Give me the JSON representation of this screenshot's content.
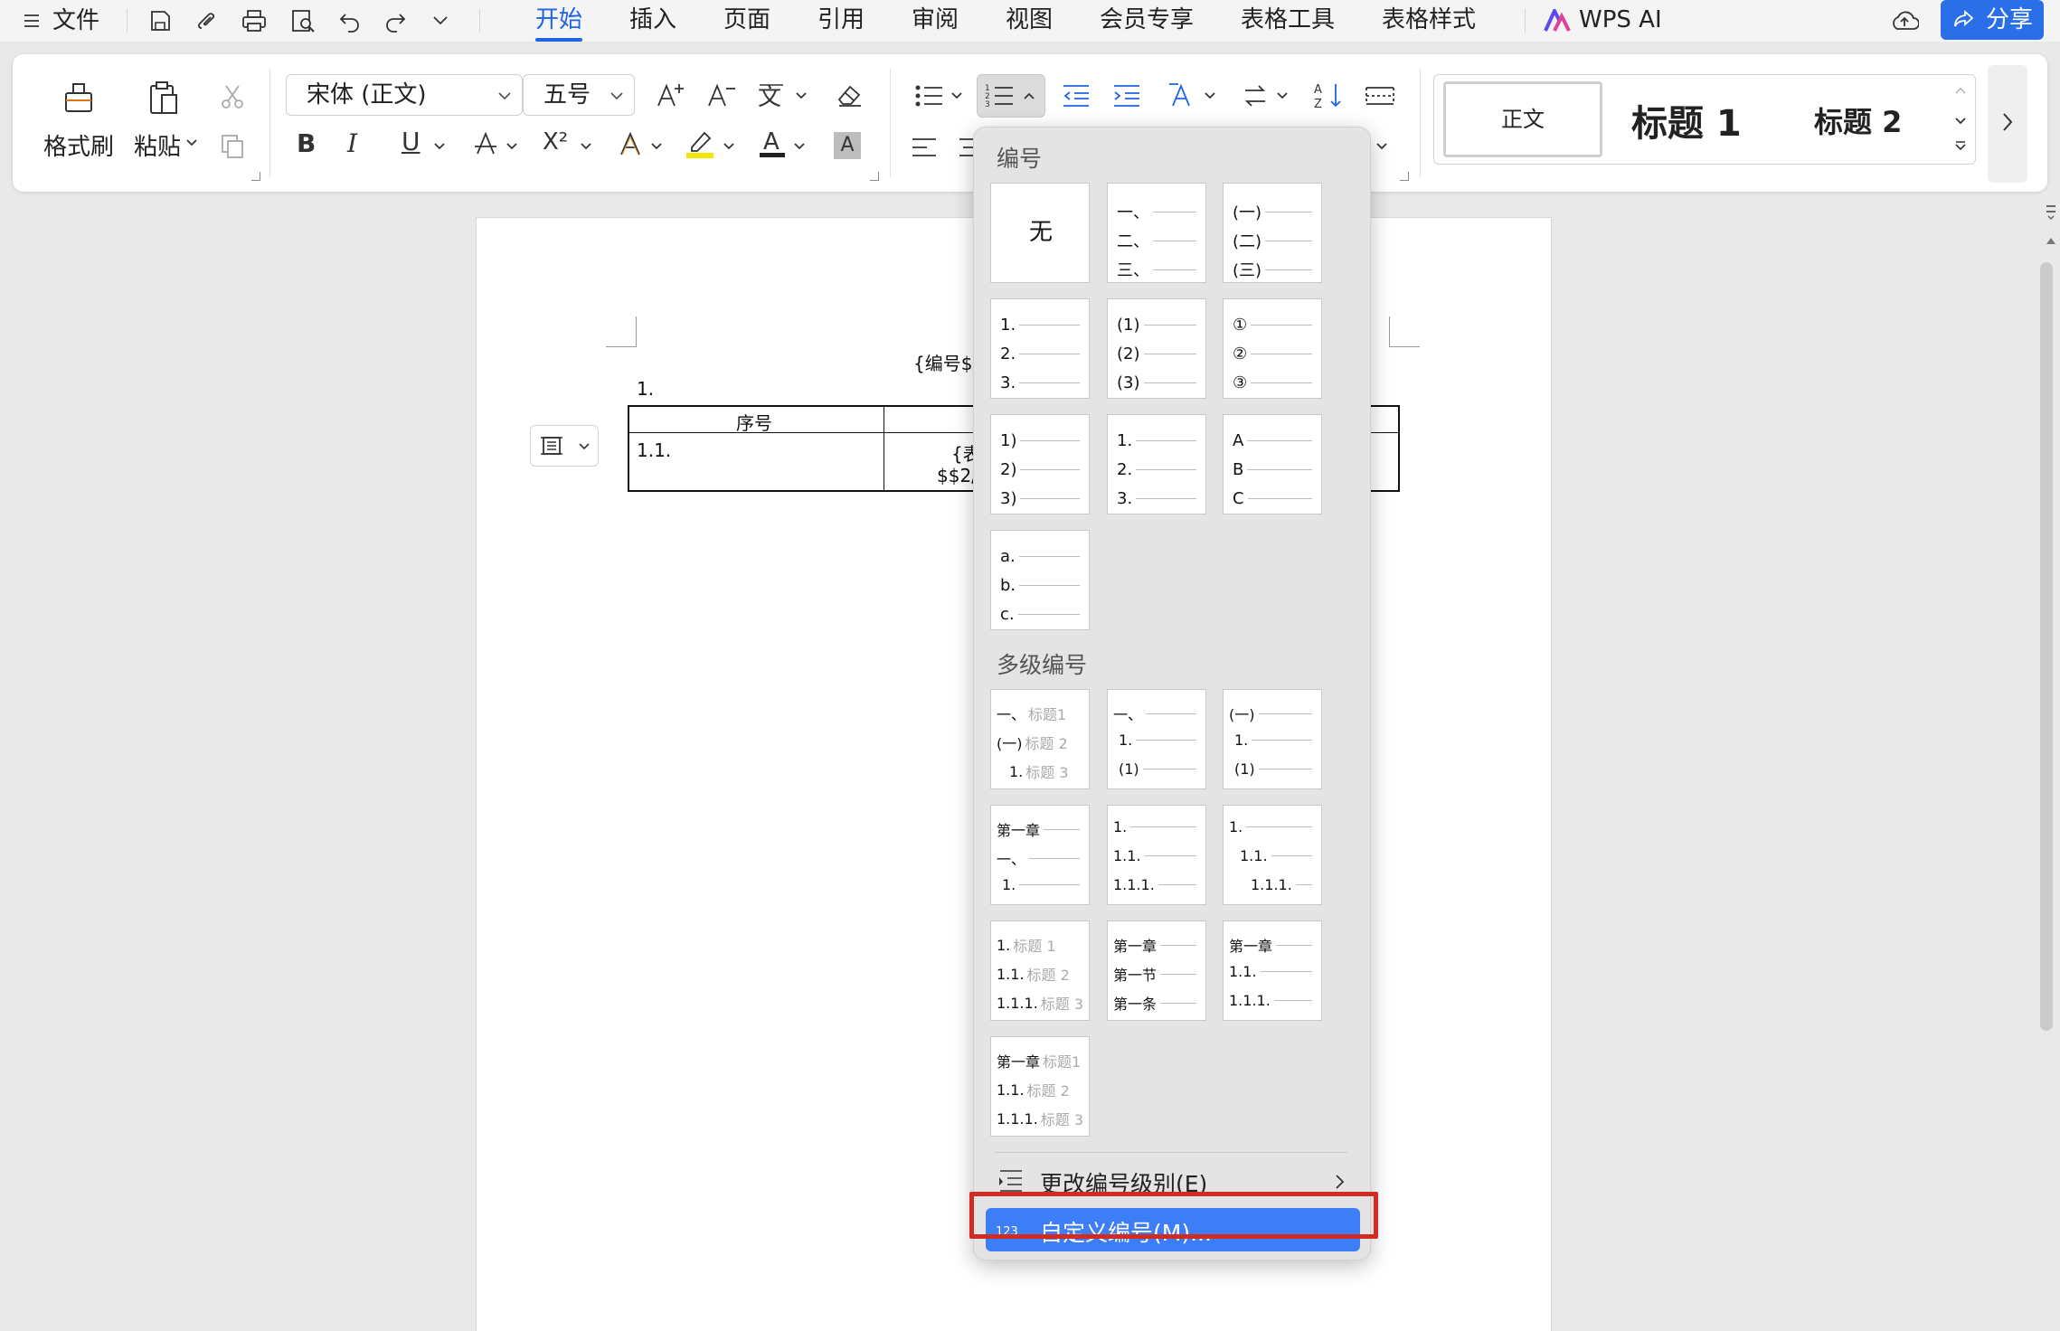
{
  "menubar": {
    "file": "文件",
    "tabs": [
      "开始",
      "插入",
      "页面",
      "引用",
      "审阅",
      "视图",
      "会员专享",
      "表格工具",
      "表格样式"
    ],
    "wps_ai": "WPS AI",
    "share": "分享"
  },
  "ribbon": {
    "format_painter": "格式刷",
    "paste": "粘贴",
    "font_name": "宋体 (正文)",
    "font_size": "五号",
    "bold": "B",
    "italic": "I",
    "underline": "U",
    "superscript": "X²",
    "font_color_letter": "A",
    "styles": {
      "normal": "正文",
      "heading1": "标题 1",
      "heading2": "标题 2"
    }
  },
  "document": {
    "title_partial": "{编号$$",
    "list_item": "1.",
    "table": {
      "header": "序号",
      "row_number": "1.1.",
      "cell_partial_1": "{表",
      "cell_partial_2": "$$2/"
    }
  },
  "dropdown": {
    "section_numbering": "编号",
    "none_label": "无",
    "numbering_tiles": [
      [
        "一、",
        "二、",
        "三、"
      ],
      [
        "(一)",
        "(二)",
        "(三)"
      ],
      [
        "1.",
        "2.",
        "3."
      ],
      [
        "(1)",
        "(2)",
        "(3)"
      ],
      [
        "①",
        "②",
        "③"
      ],
      [
        "1)",
        "2)",
        "3)"
      ],
      [
        "1.",
        "2.",
        "3."
      ],
      [
        "A",
        "B",
        "C"
      ],
      [
        "a.",
        "b.",
        "c."
      ]
    ],
    "section_multilevel": "多级编号",
    "multilevel_tiles": [
      [
        {
          "n": "一、",
          "t": "标题1"
        },
        {
          "n": "(一)",
          "t": "标题 2"
        },
        {
          "n": "1.",
          "t": "标题 3"
        }
      ],
      [
        {
          "n": "一、",
          "t": ""
        },
        {
          "n": "1.",
          "t": ""
        },
        {
          "n": "(1)",
          "t": ""
        }
      ],
      [
        {
          "n": "(一)",
          "t": ""
        },
        {
          "n": "1.",
          "t": ""
        },
        {
          "n": "(1)",
          "t": ""
        }
      ],
      [
        {
          "n": "第一章",
          "t": ""
        },
        {
          "n": "一、",
          "t": ""
        },
        {
          "n": "1.",
          "t": ""
        }
      ],
      [
        {
          "n": "1.",
          "t": ""
        },
        {
          "n": "1.1.",
          "t": ""
        },
        {
          "n": "1.1.1.",
          "t": ""
        }
      ],
      [
        {
          "n": "1.",
          "t": ""
        },
        {
          "n": "1.1.",
          "t": ""
        },
        {
          "n": "1.1.1.",
          "t": ""
        }
      ],
      [
        {
          "n": "1.",
          "t": "标题 1"
        },
        {
          "n": "1.1.",
          "t": "标题 2"
        },
        {
          "n": "1.1.1.",
          "t": "标题 3"
        }
      ],
      [
        {
          "n": "第一章",
          "t": ""
        },
        {
          "n": "第一节",
          "t": ""
        },
        {
          "n": "第一条",
          "t": ""
        }
      ],
      [
        {
          "n": "第一章",
          "t": ""
        },
        {
          "n": "1.1.",
          "t": ""
        },
        {
          "n": "1.1.1.",
          "t": ""
        }
      ],
      [
        {
          "n": "第一章",
          "t": "标题1"
        },
        {
          "n": "1.1.",
          "t": "标题 2"
        },
        {
          "n": "1.1.1.",
          "t": "标题 3"
        }
      ]
    ],
    "change_level": "更改编号级别(E)",
    "custom_numbering": "自定义编号(M)..."
  },
  "colors": {
    "accent": "#1e64e6",
    "highlight": "#3d7df5",
    "red_box": "#d12b22"
  }
}
